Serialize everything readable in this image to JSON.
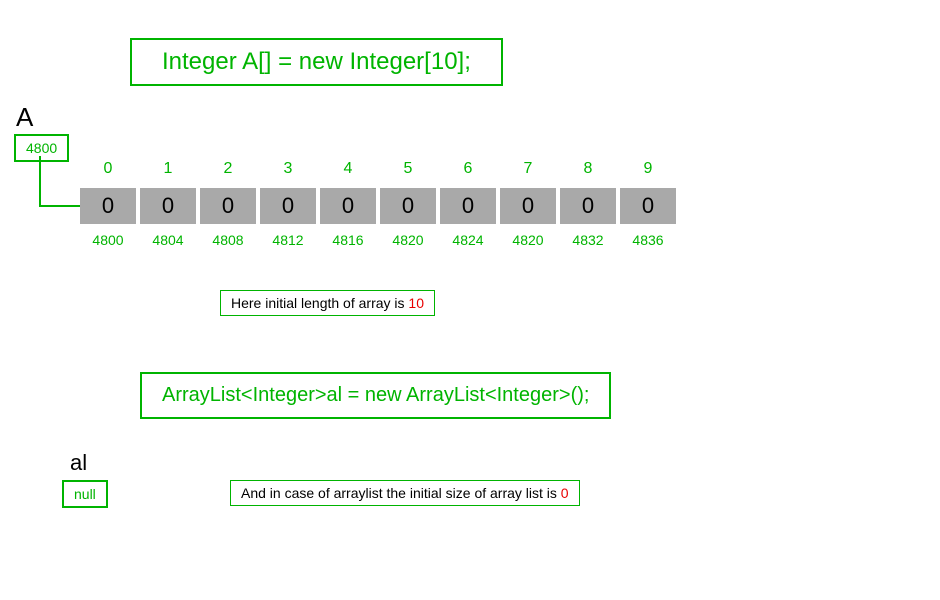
{
  "top": {
    "declaration": "Integer A[] = new Integer[10];",
    "variable": "A",
    "pointer_value": "4800",
    "indices": [
      "0",
      "1",
      "2",
      "3",
      "4",
      "5",
      "6",
      "7",
      "8",
      "9"
    ],
    "cells": [
      "0",
      "0",
      "0",
      "0",
      "0",
      "0",
      "0",
      "0",
      "0",
      "0"
    ],
    "addresses": [
      "4800",
      "4804",
      "4808",
      "4812",
      "4816",
      "4820",
      "4824",
      "4820",
      "4832",
      "4836"
    ],
    "note_prefix": "Here initial length of array  is ",
    "note_value": "10"
  },
  "bottom": {
    "declaration": "ArrayList<Integer>al = new ArrayList<Integer>();",
    "variable": "al",
    "pointer_value": "null",
    "note_prefix": "And in case of arraylist the initial size of array list is ",
    "note_value": "0"
  },
  "chart_data": {
    "type": "table",
    "title": "Java Integer[] vs ArrayList<Integer> initial state",
    "array": {
      "declaration": "Integer A[] = new Integer[10];",
      "variable": "A",
      "base_address": 4800,
      "indices": [
        0,
        1,
        2,
        3,
        4,
        5,
        6,
        7,
        8,
        9
      ],
      "values": [
        0,
        0,
        0,
        0,
        0,
        0,
        0,
        0,
        0,
        0
      ],
      "addresses": [
        4800,
        4804,
        4808,
        4812,
        4816,
        4820,
        4824,
        4820,
        4832,
        4836
      ],
      "initial_length": 10
    },
    "arraylist": {
      "declaration": "ArrayList<Integer>al = new ArrayList<Integer>();",
      "variable": "al",
      "reference": "null",
      "initial_size": 0
    }
  }
}
